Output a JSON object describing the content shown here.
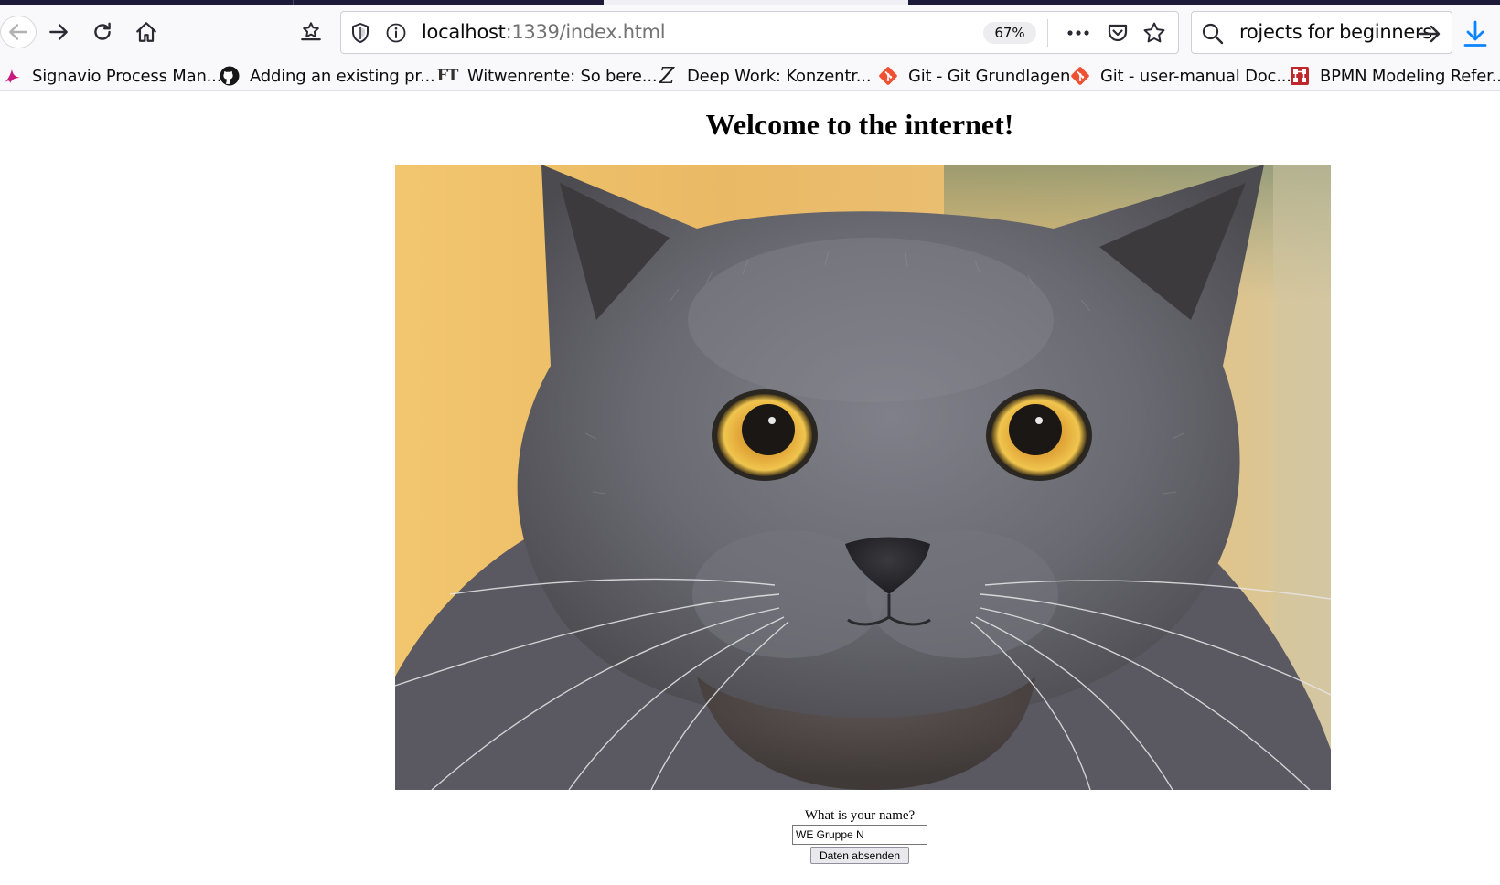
{
  "browser": {
    "url_host": "localhost",
    "url_rest": ":1339/index.html",
    "zoom": "67%",
    "search_text": "rojects for beginners"
  },
  "bookmarks": [
    {
      "label": "Signavio Process Man...",
      "icon": "signavio-icon"
    },
    {
      "label": "Adding an existing pr...",
      "icon": "github-icon"
    },
    {
      "label": "Witwenrente: So bere...",
      "icon": "ft-icon",
      "icon_text": "FT"
    },
    {
      "label": "Deep Work: Konzentr...",
      "icon": "zeit-icon",
      "icon_text": "Z"
    },
    {
      "label": "Git - Git Grundlagen",
      "icon": "git-icon"
    },
    {
      "label": "Git - user-manual Doc...",
      "icon": "git-icon"
    },
    {
      "label": "BPMN Modeling Refer...",
      "icon": "bpmn-icon"
    }
  ],
  "page": {
    "title": "Welcome to the internet!",
    "image": "grey-cat-photo",
    "form": {
      "label": "What is your name?",
      "input_value": "WE Gruppe N",
      "submit_label": "Daten absenden"
    }
  },
  "colors": {
    "tab_strip": "#1d1b39",
    "toolbar": "#f9f9fb",
    "git_orange": "#f05133",
    "signavio_pink": "#c8197f",
    "bpmn_red": "#c0272d"
  }
}
